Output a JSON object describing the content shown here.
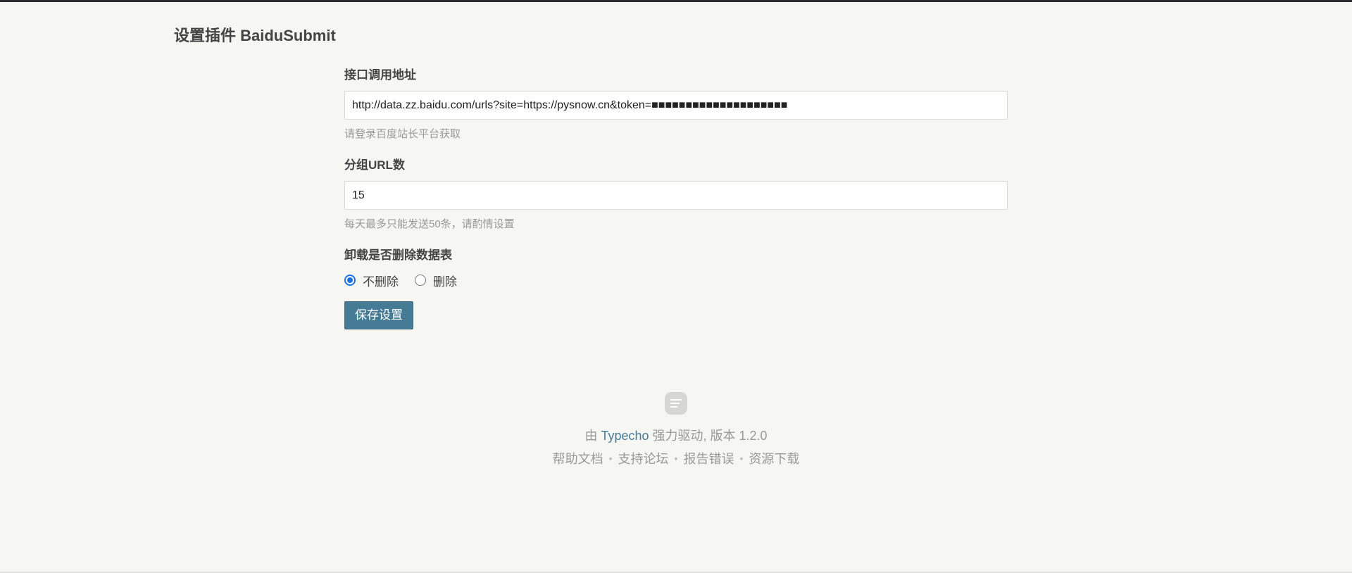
{
  "page": {
    "title": "设置插件 BaiduSubmit"
  },
  "form": {
    "api": {
      "label": "接口调用地址",
      "value": "http://data.zz.baidu.com/urls?site=https://pysnow.cn&token=■■■■■■■■■■■■■■■■■■■■",
      "description": "请登录百度站长平台获取"
    },
    "group": {
      "label": "分组URL数",
      "value": "15",
      "description": "每天最多只能发送50条，请酌情设置"
    },
    "uninstall": {
      "label": "卸载是否删除数据表",
      "options": [
        {
          "label": "不删除",
          "checked": true
        },
        {
          "label": "删除",
          "checked": false
        }
      ]
    },
    "save_label": "保存设置"
  },
  "footer": {
    "powered_prefix": "由",
    "brand": "Typecho",
    "powered_suffix": "强力驱动, 版本 1.2.0",
    "separator": "•",
    "links": [
      "帮助文档",
      "支持论坛",
      "报告错误",
      "资源下载"
    ]
  },
  "colors": {
    "background": "#f6f6f3",
    "primary_button": "#467b96",
    "link": "#467b96",
    "radio_checked": "#1a73e8"
  }
}
